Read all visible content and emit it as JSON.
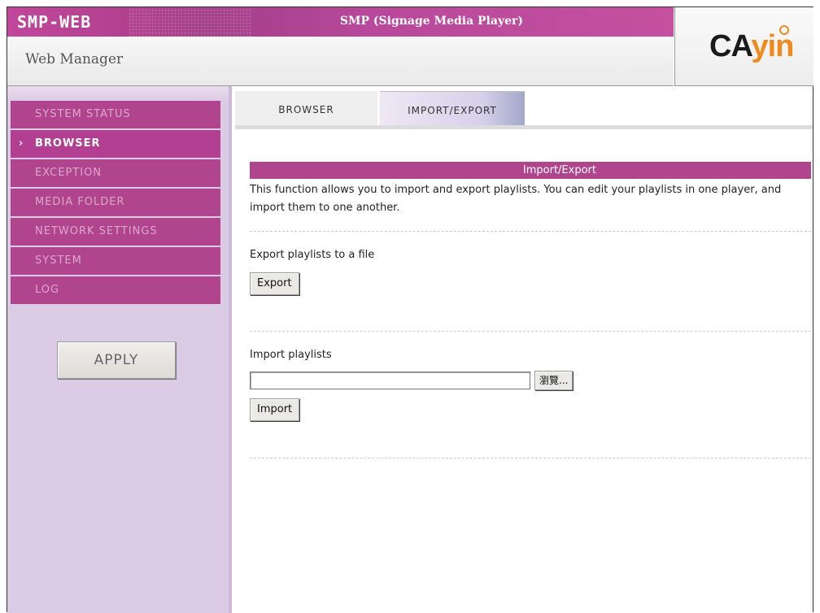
{
  "header": {
    "brand": "SMP-WEB",
    "product": "SMP (Signage Media Player)",
    "subtitle": "Web Manager",
    "logo_part1": "CA",
    "logo_part2": "yin"
  },
  "sidebar": {
    "items": [
      {
        "label": "SYSTEM STATUS",
        "active": false
      },
      {
        "label": "BROWSER",
        "active": true
      },
      {
        "label": "EXCEPTION",
        "active": false
      },
      {
        "label": "MEDIA FOLDER",
        "active": false
      },
      {
        "label": "NETWORK SETTINGS",
        "active": false
      },
      {
        "label": "SYSTEM",
        "active": false
      },
      {
        "label": "LOG",
        "active": false
      }
    ],
    "apply_label": "APPLY"
  },
  "tabs": [
    {
      "label": "BROWSER",
      "active": false
    },
    {
      "label": "IMPORT/EXPORT",
      "active": true
    }
  ],
  "main": {
    "section_title": "Import/Export",
    "description": "This function allows you to import and export playlists. You can edit your playlists in one player, and import them to one another.",
    "export_label": "Export playlists to a file",
    "export_button": "Export",
    "import_label": "Import playlists",
    "file_value": "",
    "browse_button": "瀏覽...",
    "import_button": "Import"
  },
  "colors": {
    "accent": "#b0458e",
    "sidebar_bg": "#dccbe4",
    "logo_orange": "#f08a1c"
  }
}
